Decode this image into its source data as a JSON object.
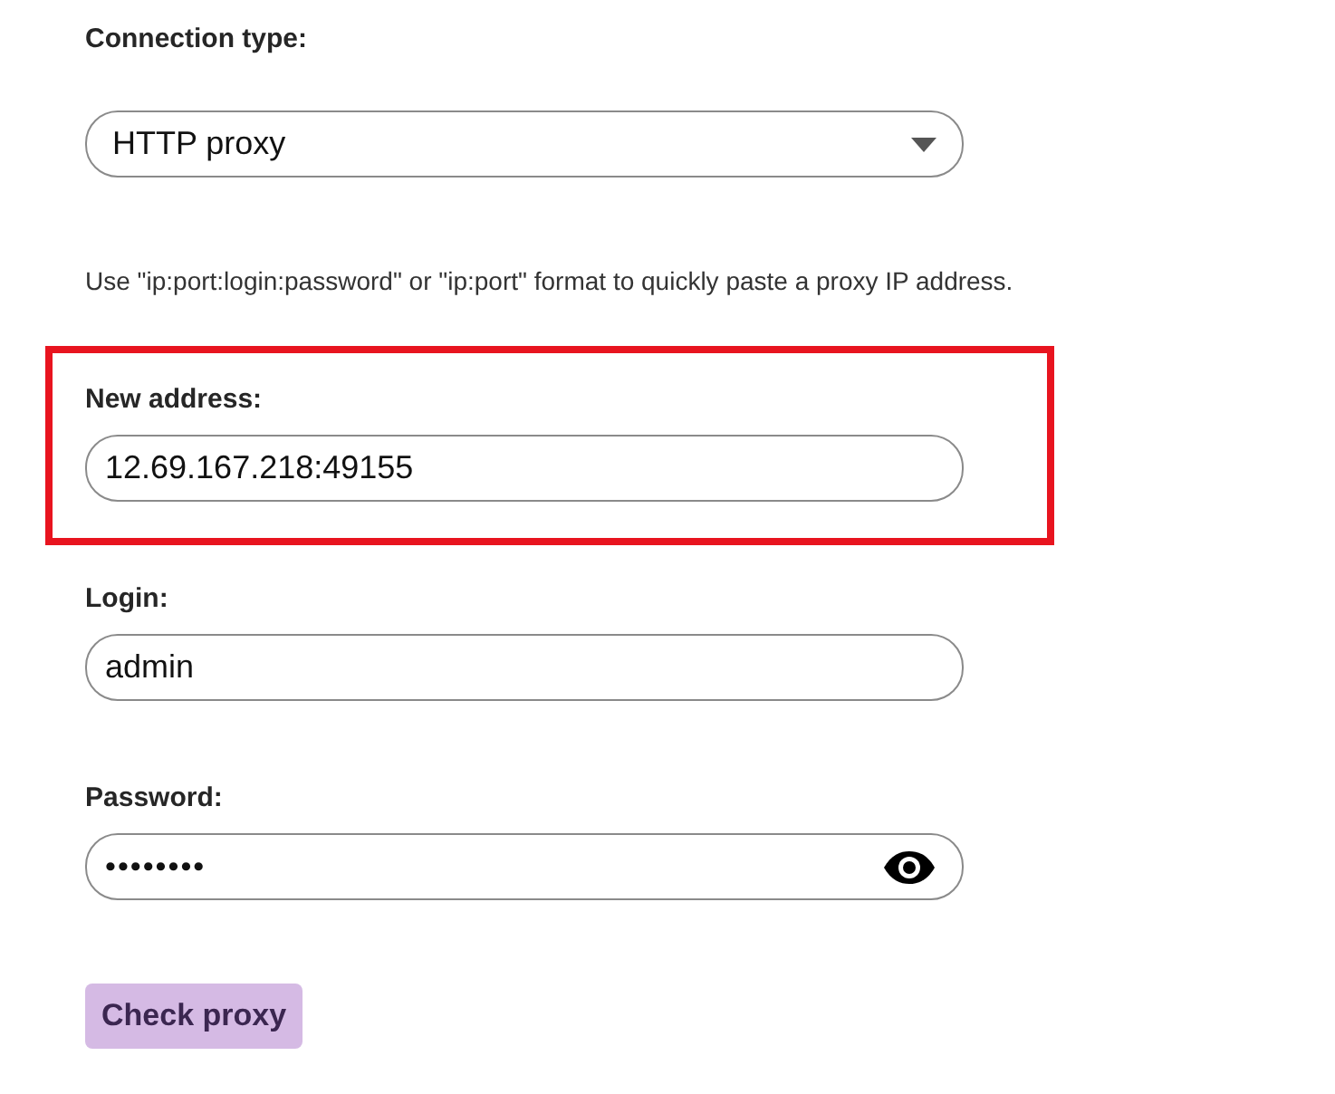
{
  "connection_type": {
    "label": "Connection type:",
    "value": "HTTP proxy"
  },
  "hint": "Use \"ip:port:login:password\" or \"ip:port\" format to quickly paste a proxy IP address.",
  "fields": [
    {
      "kind": "text",
      "label": "New address:",
      "value": "12.69.167.218:49155",
      "highlighted": true
    },
    {
      "kind": "text",
      "label": "Login:",
      "value": "admin",
      "highlighted": false
    },
    {
      "kind": "password",
      "label": "Password:",
      "value": "••••••••",
      "highlighted": false
    }
  ],
  "button": "Check proxy"
}
